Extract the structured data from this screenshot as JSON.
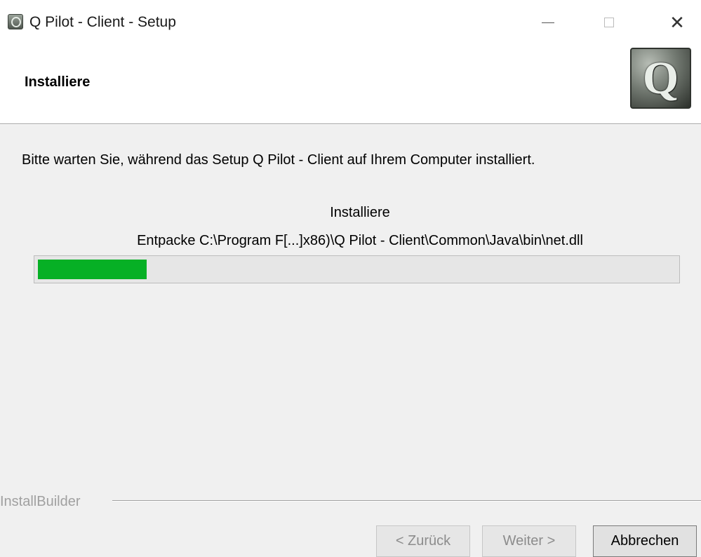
{
  "window": {
    "title": "Q Pilot - Client - Setup",
    "minimize_glyph": "—",
    "close_glyph": "✕"
  },
  "header": {
    "title": "Installiere",
    "logo_letter": "Q"
  },
  "main": {
    "description": "Bitte warten Sie, während das Setup Q Pilot - Client auf Ihrem Computer installiert.",
    "status": "Installiere",
    "detail": "Entpacke C:\\Program F[...]x86)\\Q Pilot - Client\\Common\\Java\\bin\\net.dll",
    "progress_fraction": 0.17,
    "progress_color": "#06b025"
  },
  "footer": {
    "brand": "InstallBuilder",
    "back_label": "< Zurück",
    "next_label": "Weiter >",
    "cancel_label": "Abbrechen"
  },
  "icons": {
    "app": "q-pilot-app-icon",
    "logo": "q-pilot-logo"
  }
}
